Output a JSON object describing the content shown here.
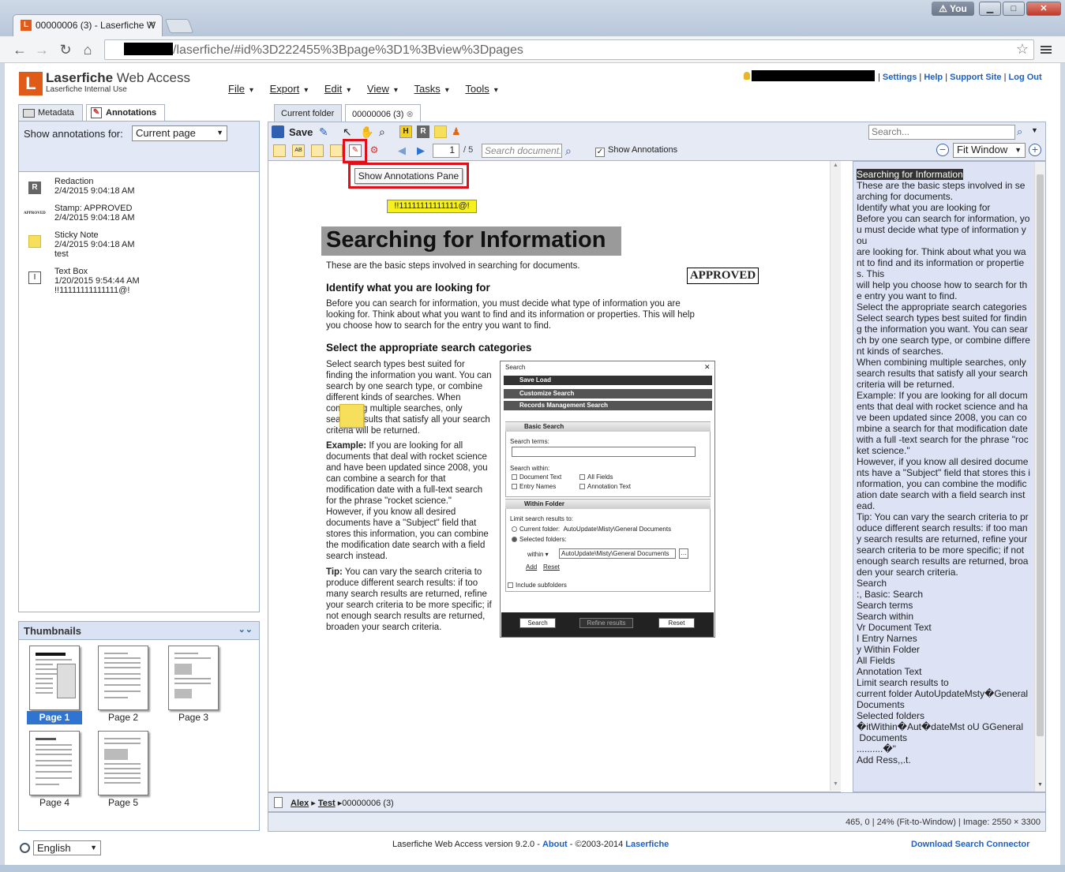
{
  "browser": {
    "tab_title": "00000006 (3) - Laserfiche W",
    "tab_icon": "L",
    "you_label": "You",
    "url": "/laserfiche/#id%3D222455%3Bpage%3D1%3Bview%3Dpages"
  },
  "app": {
    "logo_letter": "L",
    "title_bold": "Laserfiche",
    "title_light": " Web Access",
    "subtitle": "Laserfiche Internal Use",
    "menu": [
      "File",
      "Export",
      "Edit",
      "View",
      "Tasks",
      "Tools"
    ],
    "user_links": [
      "Settings",
      "Help",
      "Support Site",
      "Log Out"
    ]
  },
  "left_panel": {
    "tabs": [
      "Metadata",
      "Annotations"
    ],
    "show_annotations_label": "Show annotations for:",
    "show_annotations_value": "Current page",
    "annotations": [
      {
        "icon": "redaction-icon",
        "title": "Redaction",
        "date": "2/4/2015 9:04:18 AM",
        "note": ""
      },
      {
        "icon": "stamp-icon",
        "title": "Stamp: APPROVED",
        "date": "2/4/2015 9:04:18 AM",
        "note": ""
      },
      {
        "icon": "sticky-note-icon",
        "title": "Sticky Note",
        "date": "2/4/2015 9:04:18 AM",
        "note": "test"
      },
      {
        "icon": "text-box-icon",
        "title": "Text Box",
        "date": "1/20/2015 9:54:44 AM",
        "note": "!!11111111111111@!"
      }
    ],
    "stamp_icon_text": "APPROVED",
    "redaction_icon_text": "R",
    "thumbnails_title": "Thumbnails",
    "thumbnails": [
      "Page 1",
      "Page 2",
      "Page 3",
      "Page 4",
      "Page 5"
    ],
    "language": "English"
  },
  "doc_tabs": [
    "Current folder",
    "00000006 (3)"
  ],
  "viewer": {
    "save_label": "Save",
    "search_placeholder": "Search...",
    "page_number": "1",
    "page_total": "/ 5",
    "search_document_placeholder": "Search document...",
    "show_annotations_label": "Show Annotations",
    "show_annotations_checked": "✓",
    "fit_value": "Fit Window",
    "tooltip": "Show Annotations Pane",
    "highlight_icon_text": "H",
    "redact_icon_text": "R"
  },
  "document": {
    "textbox_annotation": "!!11111111111111@!",
    "title": "Searching for Information",
    "intro": "These are the basic steps involved in searching for documents.",
    "h1": "Identify what you are looking for",
    "p1": "Before you can search for information, you must decide what type of information you are looking for. Think about what you want to find and its information or properties. This will help you choose how to search for the entry you want to find.",
    "h2": "Select the appropriate search categories",
    "p2": "Select search types best suited for finding the information you want. You can search by one search type, or combine different kinds of searches. When combining multiple searches, only search results that satisfy all your search criteria will be returned.",
    "example_label": "Example:",
    "p3": " If you are looking for all documents that deal with rocket science and have been updated since 2008, you can combine a search for that modification date with a full-text search for the phrase \"rocket science.\" However, if you know all desired documents have a \"Subject\" field that stores this information, you can combine the modification date search with a field search instead.",
    "tip_label": "Tip:",
    "p4": " You can vary the search criteria to produce different search results: if too many search results are returned, refine your search criteria to be more specific; if not enough search results are returned, broaden your search criteria.",
    "stamp": "APPROVED",
    "search_dialog": {
      "title": "Search",
      "save_load": "Save  Load",
      "customize": "Customize Search",
      "records": "Records Management Search",
      "basic": "Basic Search",
      "search_terms": "Search terms:",
      "search_within": "Search within:",
      "doc_text": "Document Text",
      "all_fields": "All Fields",
      "entry_names": "Entry Names",
      "annotation_text": "Annotation Text",
      "within_folder": "Within Folder",
      "limit": "Limit search results to:",
      "current_folder": "Current folder:",
      "current_folder_path": "AutoUpdate\\Misty\\General Documents",
      "selected_folders": "Selected folders:",
      "within": "within",
      "within_path": "AutoUpdate\\Misty\\General Documents",
      "add": "Add",
      "reset_link": "Reset",
      "include_sub": "Include subfolders",
      "btn_search": "Search",
      "btn_refine": "Refine results",
      "btn_reset": "Reset"
    }
  },
  "text_pane": {
    "heading": "Searching for Information",
    "body": "These are the basic steps involved in searching for documents.\nIdentify what you are looking for\nBefore you can search for information, you must decide what type of information you\nare looking for. Think about what you want to find and its information or properties. This\nwill help you choose how to search for the entry you want to find.\nSelect the appropriate search categories\nSelect search types best suited for finding the information you want. You can search by one search type, or combine different kinds of searches.\nWhen combining multiple searches, only search results that satisfy all your search criteria will be returned.\nExample: If you are looking for all documents that deal with rocket science and have been updated since 2008, you can combine a search for that modification date with a full -text search for the phrase \"rocket science.\"\nHowever, if you know all desired documents have a \"Subject\" field that stores this information, you can combine the modification date search with a field search instead.\nTip: You can vary the search criteria to produce different search results: if too many search results are returned, refine your search criteria to be more specific; if not enough search results are returned, broaden your search criteria.\nSearch\n:, Basic: Search\nSearch terms\nSearch within\nVr Document Text\nI Entry Narnes\ny Within Folder\nAll Fields\nAnnotation Text\nLimit search results to\ncurrent folder AutoUpdateMsty�General Documents\nSelected folders\n�itWithin�Aut�dateMst oU GGeneral\n Documents\n..........�\"\nAdd Ress,,.t."
  },
  "path_bar": {
    "crumbs": [
      "Alex",
      "Test"
    ],
    "current": "00000006 (3)"
  },
  "status_bar": "465, 0 | 24% (Fit-to-Window) | Image: 2550 × 3300",
  "footer": {
    "version_text": "Laserfiche Web Access version 9.2.0 - ",
    "about": "About",
    "copyright": " - ©2003-2014 ",
    "company": "Laserfiche",
    "download": "Download Search Connector"
  },
  "colors": {
    "brand": "#e05a18",
    "link": "#1f5fbf",
    "panel": "#e3e8f7",
    "highlight_red": "#e0101a"
  }
}
